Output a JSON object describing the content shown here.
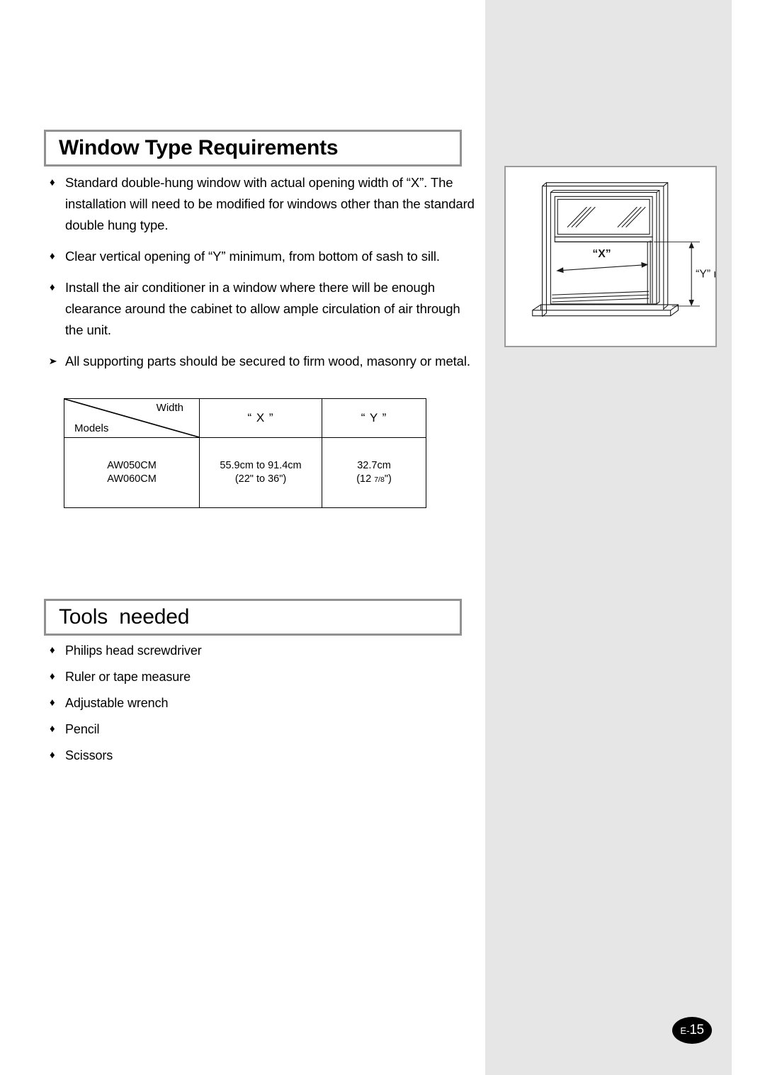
{
  "page": {
    "number_prefix": "E-",
    "number": "15",
    "badge_color": "#000000"
  },
  "sections": [
    {
      "id": "window-type-requirements",
      "heading": "Window Type Requirements",
      "bullets": [
        {
          "marker": "♦",
          "text": "Standard double-hung window with actual opening width of “X”. The installation will need to be modified for windows other than the standard double hung type."
        },
        {
          "marker": "♦",
          "text": "Clear vertical opening of “Y” minimum, from bottom of sash to sill."
        },
        {
          "marker": "♦",
          "text": "Install the air conditioner in a window where there will be enough clearance around the cabinet to allow ample circulation of air through the unit."
        },
        {
          "marker": "➤",
          "text": "All supporting parts should be secured to firm wood, masonry or metal."
        }
      ]
    },
    {
      "id": "tools-needed",
      "heading": "Tools  needed",
      "bullets": [
        {
          "marker": "♦",
          "text": "Philips head screwdriver"
        },
        {
          "marker": "♦",
          "text": "Ruler or tape measure"
        },
        {
          "marker": "♦",
          "text": "Adjustable wrench"
        },
        {
          "marker": "♦",
          "text": "Pencil"
        },
        {
          "marker": "♦",
          "text": "Scissors"
        }
      ]
    }
  ],
  "spec_table": {
    "corner_top_label": "Width",
    "corner_bottom_label": "Models",
    "headers": [
      "“ X ”",
      "“ Y ”"
    ],
    "rows": [
      {
        "models": [
          "AW050CM",
          "AW060CM"
        ],
        "x_metric": "55.9cm to 91.4cm",
        "x_imperial_prefix": "(22\" to 36\")",
        "y_metric": "32.7cm",
        "y_imperial_prefix": "(12 ",
        "y_imperial_fraction": "7/8",
        "y_imperial_suffix": "\")"
      }
    ]
  },
  "diagram": {
    "name": "double-hung-window-diagram",
    "label_x": "“X”",
    "label_y": "“Y” min"
  }
}
